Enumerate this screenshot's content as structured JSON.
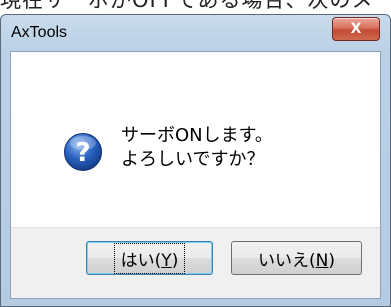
{
  "background_text": "現在サーボがOFFである場合、次のメ",
  "window": {
    "title": "AxTools",
    "close_glyph": "X"
  },
  "dialog": {
    "icon": "question-icon",
    "message_line1": "サーボONします。",
    "message_line2": "よろしいですか？"
  },
  "buttons": {
    "yes": {
      "prefix": "はい(",
      "mnemonic": "Y",
      "suffix": ")"
    },
    "no": {
      "prefix": "いいえ(",
      "mnemonic": "N",
      "suffix": ")"
    }
  },
  "colors": {
    "icon_blue": "#1f4fa6",
    "close_red": "#c34a33"
  }
}
